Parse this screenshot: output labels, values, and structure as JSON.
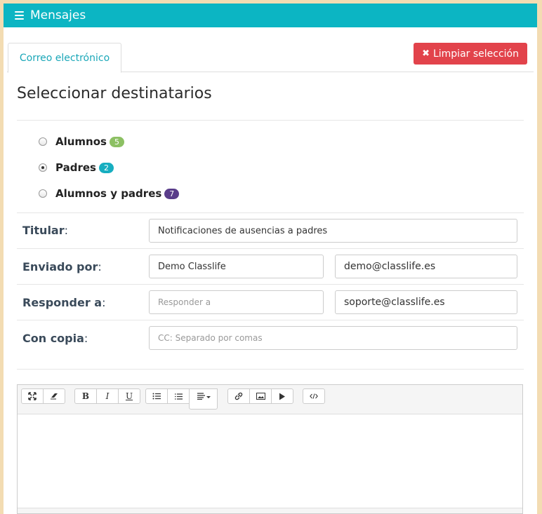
{
  "header": {
    "title": "Mensajes"
  },
  "tabs": [
    {
      "label": "Correo electrónico",
      "active": true
    }
  ],
  "clear_button": {
    "label": "Limpiar selección",
    "icon": "close-icon",
    "color": "#e2434b"
  },
  "section_title": "Seleccionar destinatarios",
  "recipients": [
    {
      "label": "Alumnos",
      "count": "5",
      "checked": false,
      "color": "#8cc063"
    },
    {
      "label": "Padres",
      "count": "2",
      "checked": true,
      "color": "#17aec0"
    },
    {
      "label": "Alumnos y padres",
      "count": "7",
      "checked": false,
      "color": "#5a3d8a"
    }
  ],
  "form": {
    "subject": {
      "label": "Titular",
      "value": "Notificaciones de ausencias a padres"
    },
    "sent_by": {
      "label": "Enviado por",
      "name": "Demo Classlife",
      "email": "demo@classlife.es"
    },
    "reply_to": {
      "label": "Responder a",
      "placeholder": "Responder a",
      "email": "soporte@classlife.es"
    },
    "cc": {
      "label": "Con copia",
      "placeholder": "CC: Separado por comas"
    }
  },
  "colon": ":",
  "editor_toolbar": {
    "fullscreen": "fullscreen-icon",
    "eraser": "eraser-icon",
    "bold": "B",
    "italic": "I",
    "underline": "U",
    "ul": "unordered-list-icon",
    "ol": "ordered-list-icon",
    "align": "align-icon",
    "link": "link-icon",
    "picture": "picture-icon",
    "video": "play-icon",
    "code": "code-icon"
  },
  "colors": {
    "accent": "#0cb5c3",
    "danger": "#e2434b",
    "background": "#f3dcb2"
  }
}
